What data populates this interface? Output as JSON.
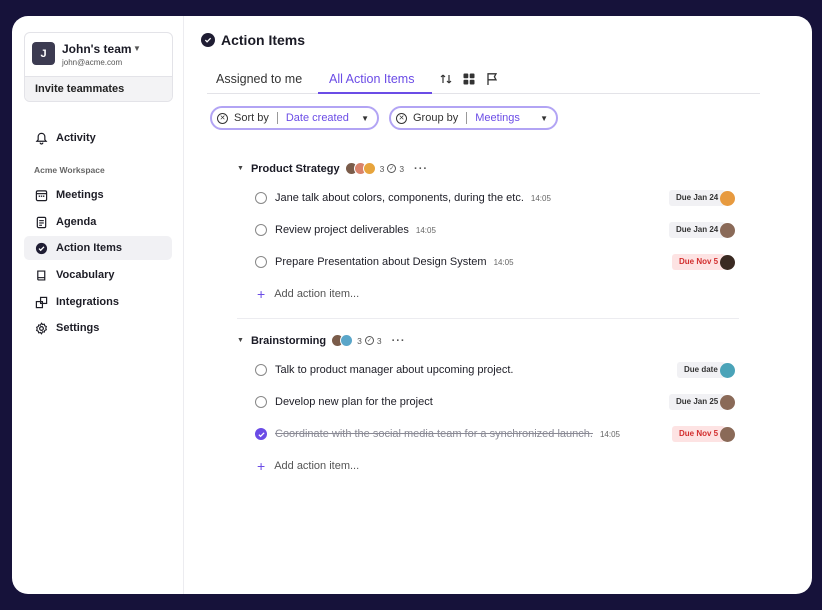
{
  "team": {
    "initial": "J",
    "name": "John's team",
    "email": "john@acme.com",
    "invite_label": "Invite teammates"
  },
  "nav": {
    "activity": "Activity",
    "workspace_label": "Acme Workspace",
    "items": [
      {
        "label": "Meetings",
        "icon": "calendar-icon"
      },
      {
        "label": "Agenda",
        "icon": "document-icon"
      },
      {
        "label": "Action Items",
        "icon": "check-circle-icon",
        "active": true
      },
      {
        "label": "Vocabulary",
        "icon": "book-icon"
      },
      {
        "label": "Integrations",
        "icon": "puzzle-icon"
      },
      {
        "label": "Settings",
        "icon": "gear-icon"
      }
    ]
  },
  "page": {
    "title": "Action Items"
  },
  "tabs": {
    "assigned": "Assigned to me",
    "all": "All Action Items"
  },
  "filters": {
    "sort_label": "Sort by",
    "sort_value": "Date created",
    "group_label": "Group by",
    "group_value": "Meetings"
  },
  "groups": [
    {
      "name": "Product Strategy",
      "count": "3",
      "done": "3",
      "items": [
        {
          "text": "Jane talk about colors, components, during the etc.",
          "time": "14:05",
          "due": "Due Jan 24",
          "overdue": false,
          "done": false
        },
        {
          "text": "Review project deliverables",
          "time": "14:05",
          "due": "Due Jan 24",
          "overdue": false,
          "done": false
        },
        {
          "text": "Prepare Presentation about Design System",
          "time": "14:05",
          "due": "Due Nov 5",
          "overdue": true,
          "done": false
        }
      ],
      "add_label": "Add action item..."
    },
    {
      "name": "Brainstorming",
      "count": "3",
      "done": "3",
      "items": [
        {
          "text": "Talk to product manager about upcoming project.",
          "time": "",
          "due": "Due date",
          "overdue": false,
          "done": false
        },
        {
          "text": "Develop new plan for the project",
          "time": "",
          "due": "Due Jan 25",
          "overdue": false,
          "done": false
        },
        {
          "text": "Coordinate with the social media team for a synchronized launch.",
          "time": "14:05",
          "due": "Due Nov 5",
          "overdue": true,
          "done": true
        }
      ],
      "add_label": "Add action item..."
    }
  ],
  "colors": {
    "accent": "#6b4ce6",
    "background": "#16123a",
    "overdue": "#d22e2e"
  }
}
